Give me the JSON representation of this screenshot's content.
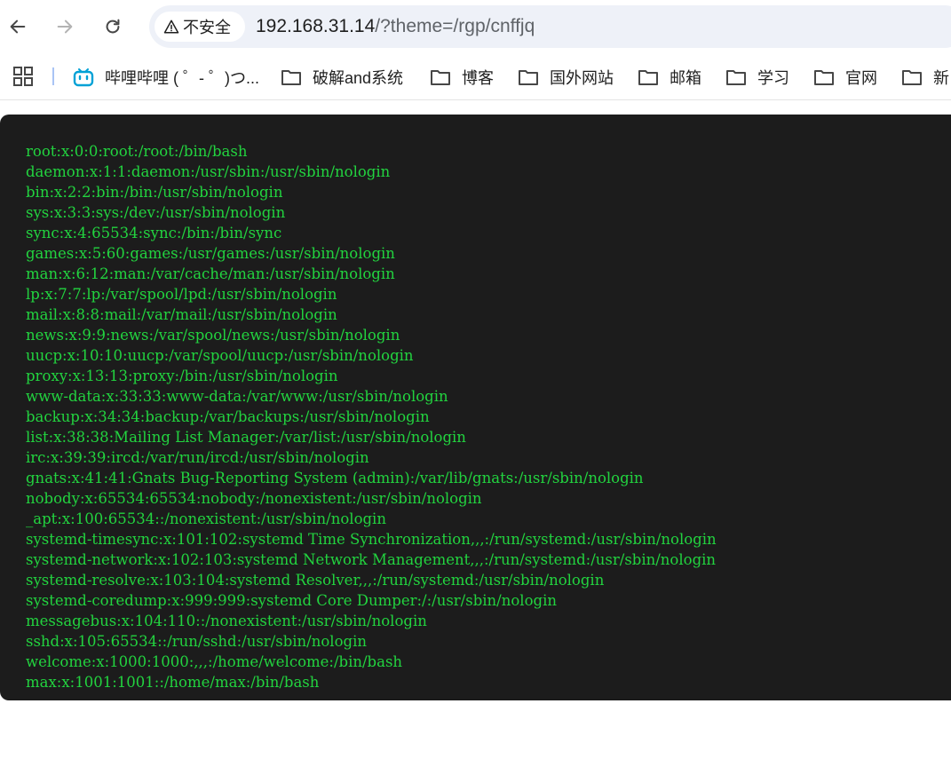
{
  "browser": {
    "security_label": "不安全",
    "url_host": "192.168.31.14",
    "url_rest": "/?theme=/rgp/cnffjq"
  },
  "bookmarks": [
    {
      "label": "哔哩哔哩 ( ゜- ゜)つ...",
      "icon": "bilibili-icon"
    },
    {
      "label": "破解and系统",
      "icon": "folder-icon"
    },
    {
      "label": "博客",
      "icon": "folder-icon"
    },
    {
      "label": "国外网站",
      "icon": "folder-icon"
    },
    {
      "label": "邮箱",
      "icon": "folder-icon"
    },
    {
      "label": "学习",
      "icon": "folder-icon"
    },
    {
      "label": "官网",
      "icon": "folder-icon"
    },
    {
      "label": "新",
      "icon": "folder-icon"
    }
  ],
  "colors": {
    "terminal_bg": "#1c1c1c",
    "terminal_text": "#22d33f",
    "bilibili": "#00a1d6"
  },
  "content": {
    "lines": [
      "root:x:0:0:root:/root:/bin/bash",
      "daemon:x:1:1:daemon:/usr/sbin:/usr/sbin/nologin",
      "bin:x:2:2:bin:/bin:/usr/sbin/nologin",
      "sys:x:3:3:sys:/dev:/usr/sbin/nologin",
      "sync:x:4:65534:sync:/bin:/bin/sync",
      "games:x:5:60:games:/usr/games:/usr/sbin/nologin",
      "man:x:6:12:man:/var/cache/man:/usr/sbin/nologin",
      "lp:x:7:7:lp:/var/spool/lpd:/usr/sbin/nologin",
      "mail:x:8:8:mail:/var/mail:/usr/sbin/nologin",
      "news:x:9:9:news:/var/spool/news:/usr/sbin/nologin",
      "uucp:x:10:10:uucp:/var/spool/uucp:/usr/sbin/nologin",
      "proxy:x:13:13:proxy:/bin:/usr/sbin/nologin",
      "www-data:x:33:33:www-data:/var/www:/usr/sbin/nologin",
      "backup:x:34:34:backup:/var/backups:/usr/sbin/nologin",
      "list:x:38:38:Mailing List Manager:/var/list:/usr/sbin/nologin",
      "irc:x:39:39:ircd:/var/run/ircd:/usr/sbin/nologin",
      "gnats:x:41:41:Gnats Bug-Reporting System (admin):/var/lib/gnats:/usr/sbin/nologin",
      "nobody:x:65534:65534:nobody:/nonexistent:/usr/sbin/nologin",
      "_apt:x:100:65534::/nonexistent:/usr/sbin/nologin",
      "systemd-timesync:x:101:102:systemd Time Synchronization,,,:/run/systemd:/usr/sbin/nologin",
      "systemd-network:x:102:103:systemd Network Management,,,:/run/systemd:/usr/sbin/nologin",
      "systemd-resolve:x:103:104:systemd Resolver,,,:/run/systemd:/usr/sbin/nologin",
      "systemd-coredump:x:999:999:systemd Core Dumper:/:/usr/sbin/nologin",
      "messagebus:x:104:110::/nonexistent:/usr/sbin/nologin",
      "sshd:x:105:65534::/run/sshd:/usr/sbin/nologin",
      "welcome:x:1000:1000:,,,:/home/welcome:/bin/bash",
      "max:x:1001:1001::/home/max:/bin/bash"
    ]
  }
}
